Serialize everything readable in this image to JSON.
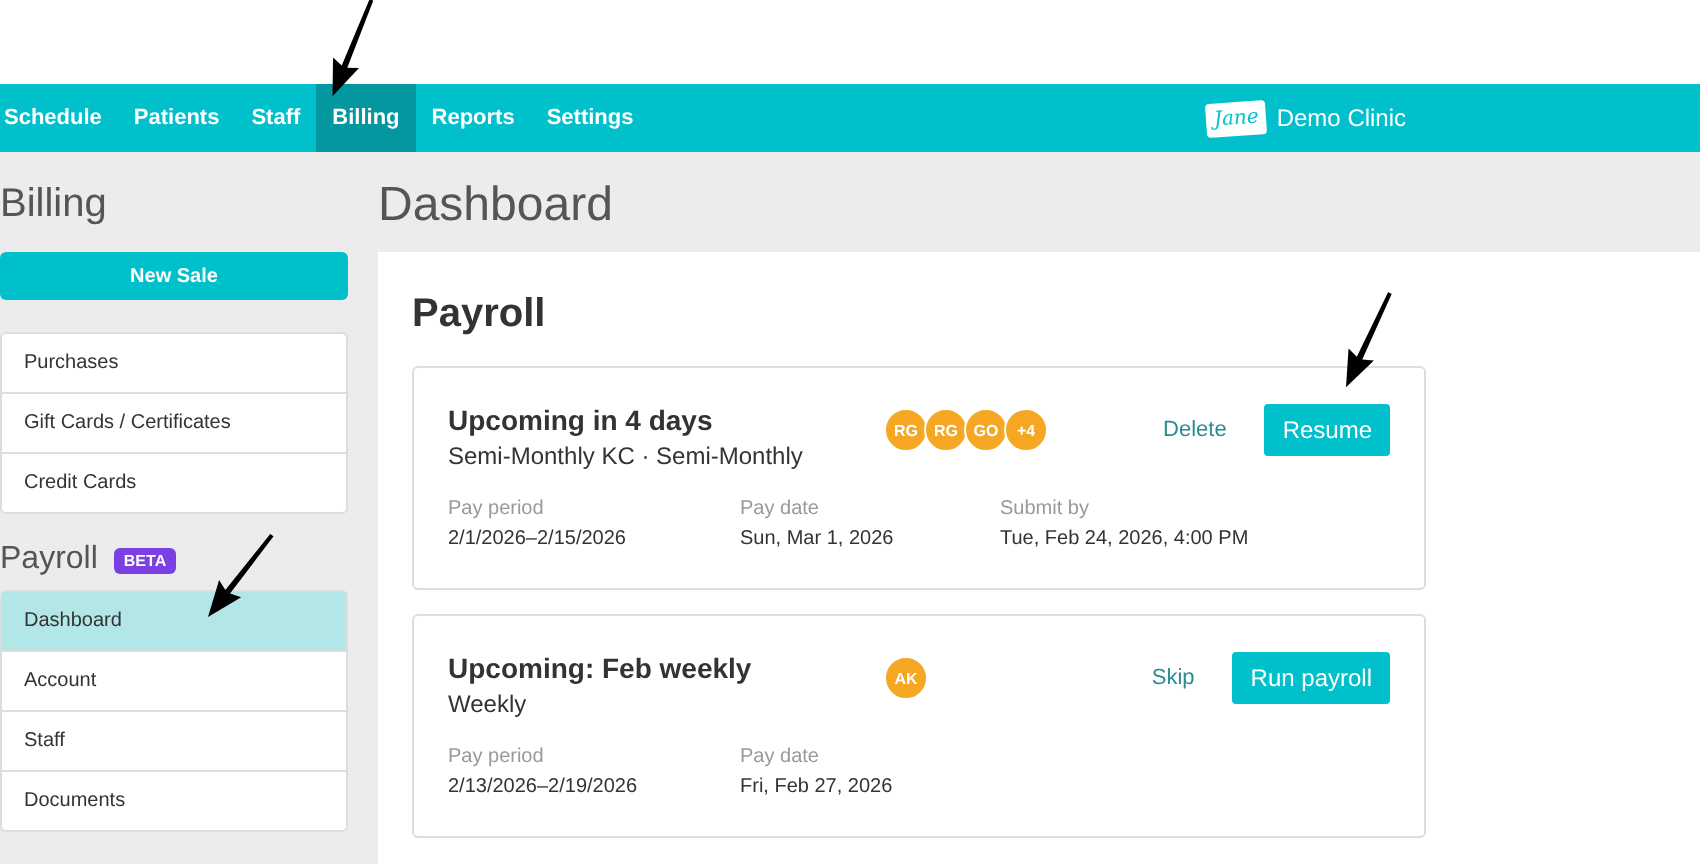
{
  "nav": {
    "items": [
      {
        "label": "Schedule",
        "selected": false
      },
      {
        "label": "Patients",
        "selected": false
      },
      {
        "label": "Staff",
        "selected": false
      },
      {
        "label": "Billing",
        "selected": true
      },
      {
        "label": "Reports",
        "selected": false
      },
      {
        "label": "Settings",
        "selected": false
      }
    ],
    "logo": "Jane",
    "clinic": "Demo Clinic"
  },
  "sidebar": {
    "title": "Billing",
    "new_sale": "New Sale",
    "billing_items": [
      {
        "label": "Purchases",
        "selected": false
      },
      {
        "label": "Gift Cards / Certificates",
        "selected": false
      },
      {
        "label": "Credit Cards",
        "selected": false
      }
    ],
    "payroll_title": "Payroll",
    "badge": "BETA",
    "payroll_items": [
      {
        "label": "Dashboard",
        "selected": true
      },
      {
        "label": "Account",
        "selected": false
      },
      {
        "label": "Staff",
        "selected": false
      },
      {
        "label": "Documents",
        "selected": false
      }
    ]
  },
  "page_title": "Dashboard",
  "section_title": "Payroll",
  "payrolls": [
    {
      "title": "Upcoming in 4 days",
      "subtitle": "Semi-Monthly KC · Semi-Monthly",
      "avatars": [
        "RG",
        "RG",
        "GO",
        "+4"
      ],
      "link": "Delete",
      "button": "Resume",
      "fields": [
        {
          "label": "Pay period",
          "value": "2/1/2026–2/15/2026"
        },
        {
          "label": "Pay date",
          "value": "Sun, Mar 1, 2026"
        },
        {
          "label": "Submit by",
          "value": "Tue, Feb 24, 2026, 4:00 PM"
        }
      ]
    },
    {
      "title": "Upcoming: Feb weekly",
      "subtitle": "Weekly",
      "avatars": [
        "AK"
      ],
      "link": "Skip",
      "button": "Run payroll",
      "fields": [
        {
          "label": "Pay period",
          "value": "2/13/2026–2/19/2026"
        },
        {
          "label": "Pay date",
          "value": "Fri, Feb 27, 2026"
        }
      ]
    }
  ]
}
